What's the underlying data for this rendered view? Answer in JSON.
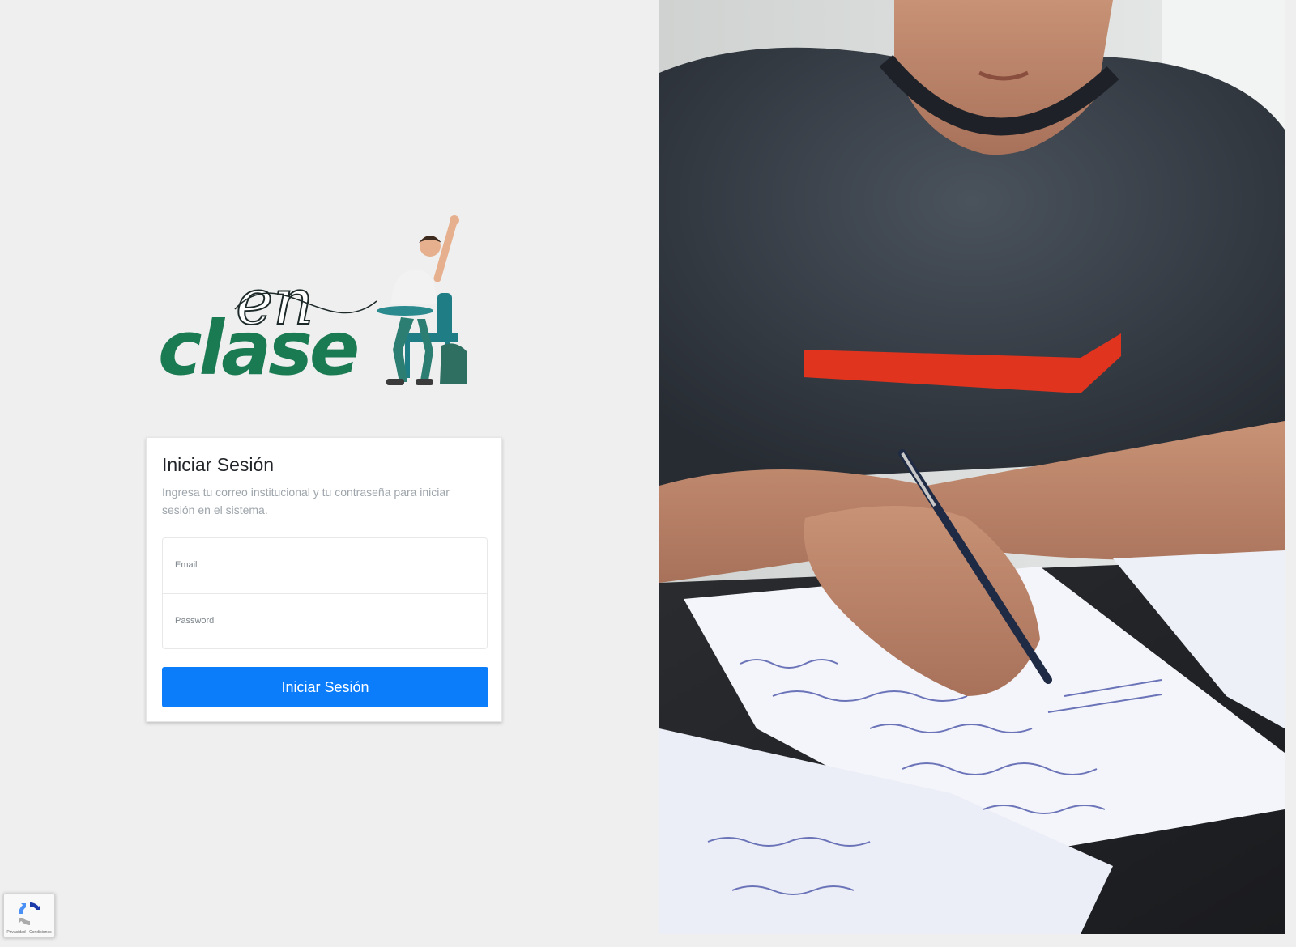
{
  "brand": {
    "logo_script": "en",
    "logo_word": "clase",
    "primary_color": "#1a7a52",
    "accent_color": "#0b7dfb"
  },
  "login": {
    "title": "Iniciar Sesión",
    "subtitle": "Ingresa tu correo institucional y tu contraseña para iniciar sesión en el sistema.",
    "email_label": "Email",
    "email_value": "",
    "password_label": "Password",
    "password_value": "",
    "submit_label": "Iniciar Sesión"
  },
  "recaptcha": {
    "icon": "recaptcha-icon",
    "footer_text": "Privacidad - Condiciones"
  },
  "hero_image": {
    "icon": "student-writing-photo"
  }
}
